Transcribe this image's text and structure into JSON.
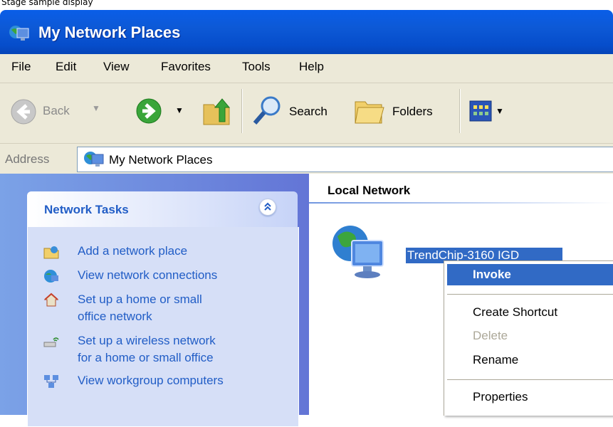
{
  "caption": "Stage sample display",
  "window": {
    "title": "My Network Places"
  },
  "menubar": {
    "items": [
      "File",
      "Edit",
      "View",
      "Favorites",
      "Tools",
      "Help"
    ]
  },
  "toolbar": {
    "back_label": "Back",
    "search_label": "Search",
    "folders_label": "Folders"
  },
  "address": {
    "label": "Address",
    "value": "My Network Places"
  },
  "tasks": {
    "title": "Network Tasks",
    "items": [
      {
        "label1": "Add a network place",
        "icon": "add-network-place-icon"
      },
      {
        "label1": "View network connections",
        "icon": "network-connections-icon"
      },
      {
        "label1": "Set up a home or small",
        "label2": "office network",
        "icon": "home-network-icon"
      },
      {
        "label1": "Set up a wireless network",
        "label2": "for a home or small office",
        "icon": "wireless-network-icon"
      },
      {
        "label1": "View workgroup computers",
        "icon": "workgroup-computers-icon"
      }
    ]
  },
  "content": {
    "group": "Local Network",
    "item_label": "TrendChip-3160 IGD"
  },
  "context_menu": {
    "items": [
      "Invoke",
      "Create Shortcut",
      "Delete",
      "Rename",
      "Properties"
    ],
    "selected": "Invoke",
    "disabled": [
      "Delete"
    ]
  },
  "colors": {
    "title_blue": "#0a5ee8",
    "selection": "#316ac5",
    "task_link": "#215dc6"
  }
}
